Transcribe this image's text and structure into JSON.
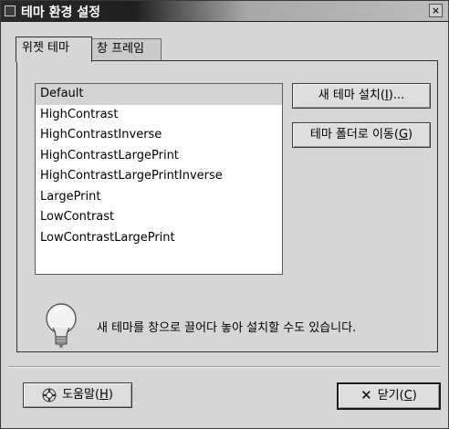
{
  "window": {
    "title": "테마 환경 설정",
    "close_symbol": "×"
  },
  "tabs": [
    {
      "label": "위젯 테마",
      "active": true
    },
    {
      "label": "창 프레임",
      "active": false
    }
  ],
  "theme_list": {
    "items": [
      "Default",
      "HighContrast",
      "HighContrastInverse",
      "HighContrastLargePrint",
      "HighContrastLargePrintInverse",
      "LargePrint",
      "LowContrast",
      "LowContrastLargePrint"
    ],
    "selected": "Default"
  },
  "buttons": {
    "install": {
      "label": "새 테마 설치(",
      "mnemonic": "I",
      "suffix": ")..."
    },
    "goto_folder": {
      "label": "테마 폴더로 이동(",
      "mnemonic": "G",
      "suffix": ")"
    },
    "help": {
      "label": "도움말(",
      "mnemonic": "H",
      "suffix": ")"
    },
    "close": {
      "label": "닫기(",
      "mnemonic": "C",
      "suffix": ")"
    }
  },
  "hint": {
    "icon": "lightbulb-icon",
    "text": "새 테마를 창으로 끌어다 놓아 설치할 수도 있습니다."
  }
}
